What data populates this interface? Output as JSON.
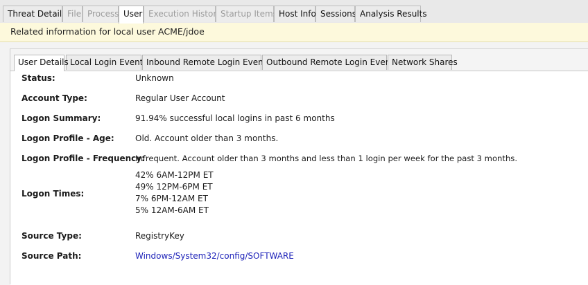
{
  "top_tabs": [
    {
      "label": "Threat Details",
      "state": "enabled"
    },
    {
      "label": "File",
      "state": "disabled"
    },
    {
      "label": "Process",
      "state": "disabled"
    },
    {
      "label": "User",
      "state": "active"
    },
    {
      "label": "Execution History",
      "state": "disabled"
    },
    {
      "label": "Startup Items",
      "state": "disabled"
    },
    {
      "label": "Host Info",
      "state": "enabled"
    },
    {
      "label": "Sessions",
      "state": "enabled"
    },
    {
      "label": "Analysis Results",
      "state": "enabled"
    }
  ],
  "banner": {
    "text": "Related information for local user ACME/jdoe"
  },
  "sub_tabs": [
    {
      "label": "User Details",
      "active": true
    },
    {
      "label": "Local Login Events",
      "active": false
    },
    {
      "label": "Inbound Remote Login Events",
      "active": false
    },
    {
      "label": "Outbound Remote Login Events",
      "active": false
    },
    {
      "label": "Network Shares",
      "active": false
    }
  ],
  "details": {
    "status": {
      "label": "Status:",
      "value": "Unknown"
    },
    "account_type": {
      "label": "Account Type:",
      "value": "Regular User Account"
    },
    "logon_summary": {
      "label": "Logon Summary:",
      "value": "91.94% successful local logins in past 6 months"
    },
    "logon_age": {
      "label": "Logon Profile - Age:",
      "value": "Old. Account older than 3 months."
    },
    "logon_frequency": {
      "label": "Logon Profile - Frequency:",
      "value": "Infrequent. Account older than 3 months and less than 1 login per week for the past 3 months."
    },
    "logon_times": {
      "label": "Logon Times:",
      "values": [
        "42% 6AM-12PM ET",
        "49% 12PM-6PM ET",
        "7% 6PM-12AM ET",
        "5% 12AM-6AM ET"
      ]
    },
    "source_type": {
      "label": "Source Type:",
      "value": "RegistryKey"
    },
    "source_path": {
      "label": "Source Path:",
      "value": "Windows/System32/config/SOFTWARE"
    }
  },
  "colors": {
    "banner_bg": "#fdf9dc",
    "link": "#1a1fb8",
    "disabled_tab_text": "#9c9c9c"
  }
}
